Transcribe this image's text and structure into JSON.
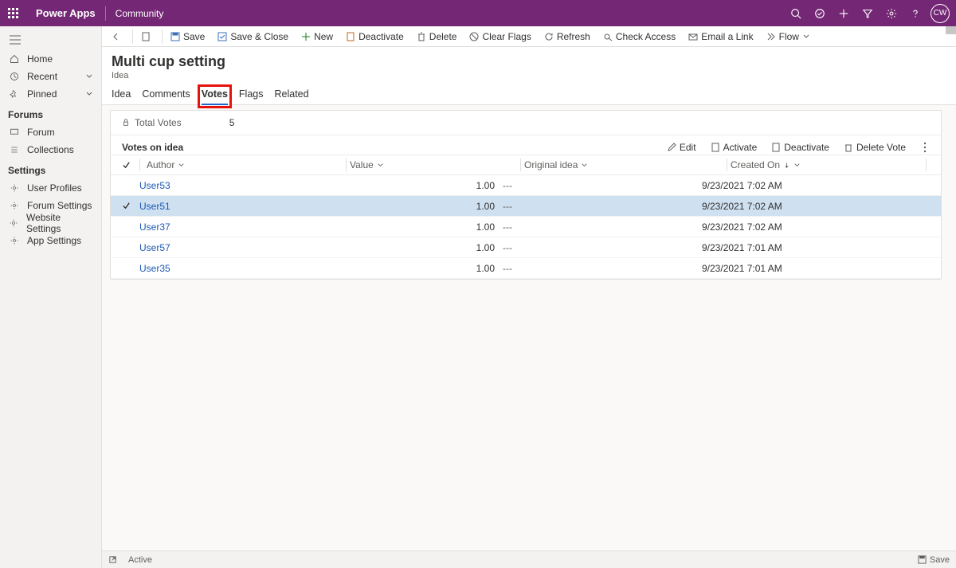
{
  "topbar": {
    "brand": "Power Apps",
    "environment": "Community",
    "avatar_initials": "CW"
  },
  "sidebar": {
    "nav": [
      {
        "id": "home",
        "label": "Home"
      },
      {
        "id": "recent",
        "label": "Recent",
        "expandable": true
      },
      {
        "id": "pinned",
        "label": "Pinned",
        "expandable": true
      }
    ],
    "sections": [
      {
        "title": "Forums",
        "items": [
          {
            "id": "forum",
            "label": "Forum"
          },
          {
            "id": "collections",
            "label": "Collections"
          }
        ]
      },
      {
        "title": "Settings",
        "items": [
          {
            "id": "user-profiles",
            "label": "User Profiles"
          },
          {
            "id": "forum-settings",
            "label": "Forum Settings"
          },
          {
            "id": "website-settings",
            "label": "Website Settings"
          },
          {
            "id": "app-settings",
            "label": "App Settings"
          }
        ]
      }
    ]
  },
  "commandbar": {
    "save": "Save",
    "save_close": "Save & Close",
    "new": "New",
    "deactivate": "Deactivate",
    "delete": "Delete",
    "clear_flags": "Clear Flags",
    "refresh": "Refresh",
    "check_access": "Check Access",
    "email_link": "Email a Link",
    "flow": "Flow"
  },
  "record": {
    "title": "Multi cup setting",
    "entity": "Idea"
  },
  "tabs": [
    "Idea",
    "Comments",
    "Votes",
    "Flags",
    "Related"
  ],
  "active_tab_index": 2,
  "summary": {
    "total_votes_label": "Total Votes",
    "total_votes_value": "5"
  },
  "grid": {
    "title": "Votes on idea",
    "cmds": {
      "edit": "Edit",
      "activate": "Activate",
      "deactivate": "Deactivate",
      "delete": "Delete Vote"
    },
    "columns": {
      "author": "Author",
      "value": "Value",
      "original": "Original idea",
      "created": "Created On"
    },
    "rows": [
      {
        "author": "User53",
        "value": "1.00",
        "original": "---",
        "created": "9/23/2021 7:02 AM",
        "selected": false
      },
      {
        "author": "User51",
        "value": "1.00",
        "original": "---",
        "created": "9/23/2021 7:02 AM",
        "selected": true
      },
      {
        "author": "User37",
        "value": "1.00",
        "original": "---",
        "created": "9/23/2021 7:02 AM",
        "selected": false
      },
      {
        "author": "User57",
        "value": "1.00",
        "original": "---",
        "created": "9/23/2021 7:01 AM",
        "selected": false
      },
      {
        "author": "User35",
        "value": "1.00",
        "original": "---",
        "created": "9/23/2021 7:01 AM",
        "selected": false
      }
    ]
  },
  "footer": {
    "status": "Active",
    "save": "Save"
  }
}
